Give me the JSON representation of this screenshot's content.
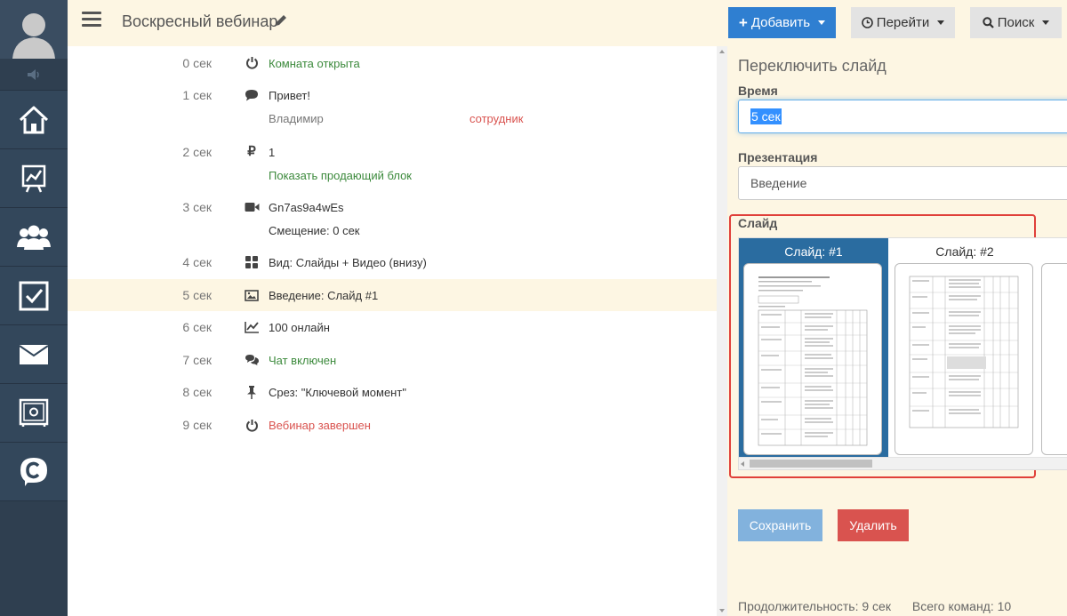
{
  "header": {
    "title": "Воскресный вебинар",
    "add_label": "Добавить",
    "go_label": "Перейти",
    "search_label": "Поиск"
  },
  "sidebar": {
    "items": [
      {
        "icon": "home-icon"
      },
      {
        "icon": "presentation-chart-icon"
      },
      {
        "icon": "users-icon"
      },
      {
        "icon": "checkbox-icon"
      },
      {
        "icon": "mail-icon"
      },
      {
        "icon": "safe-icon"
      },
      {
        "icon": "chat-c-logo-icon"
      }
    ]
  },
  "timeline": {
    "events": [
      {
        "time": "0 сек",
        "icon": "power-icon",
        "text": "Комната открыта"
      },
      {
        "time": "1 сек",
        "icon": "comment-icon",
        "text": "Привет!",
        "author": "Владимир",
        "role": "сотрудник"
      },
      {
        "time": "2 сек",
        "icon": "ruble-icon",
        "text": "1",
        "sub": "Показать продающий блок"
      },
      {
        "time": "3 сек",
        "icon": "video-camera-icon",
        "text": "Gn7as9a4wEs",
        "sub": "Смещение: 0 сек"
      },
      {
        "time": "4 сек",
        "icon": "grid-icon",
        "text": "Вид: Слайды + Видео (внизу)"
      },
      {
        "time": "5 сек",
        "icon": "image-icon",
        "text": "Введение: Слайд #1"
      },
      {
        "time": "6 сек",
        "icon": "line-chart-icon",
        "text": "100 онлайн"
      },
      {
        "time": "7 сек",
        "icon": "comments-icon",
        "text": "Чат включен"
      },
      {
        "time": "8 сек",
        "icon": "pin-icon",
        "text": "Срез: \"Ключевой момент\""
      },
      {
        "time": "9 сек",
        "icon": "power-icon",
        "text": "Вебинар завершен"
      }
    ]
  },
  "panel": {
    "title": "Переключить слайд",
    "time_label": "Время",
    "time_value": "5 сек",
    "presentation_label": "Презентация",
    "presentation_value": "Введение",
    "slide_label": "Слайд",
    "slides": [
      {
        "label": "Слайд: #1",
        "selected": true
      },
      {
        "label": "Слайд: #2",
        "selected": false
      }
    ],
    "save_label": "Сохранить",
    "delete_label": "Удалить",
    "duration": "Продолжительность: 9 сек",
    "total_commands": "Всего команд: 10"
  },
  "colors": {
    "accent": "#2f7fd1",
    "panel_bg": "#fdf6e3",
    "sidebar_bg": "#2f3f50",
    "danger": "#d9534f",
    "success_text": "#3c8a3c",
    "selected_slide": "#2a6ca0"
  }
}
